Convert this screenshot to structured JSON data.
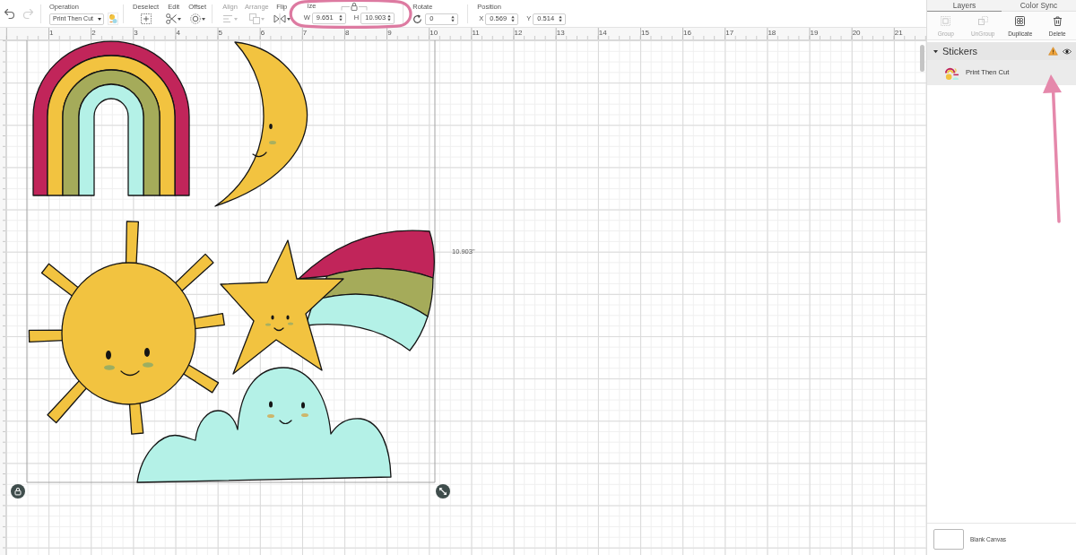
{
  "toolbar": {
    "history": [
      {
        "kind": "undo",
        "disabled": false
      },
      {
        "kind": "redo",
        "disabled": true
      }
    ],
    "operation": {
      "label": "Operation",
      "value": "Print Then Cut"
    },
    "tool_groups": [
      [
        {
          "kind": "deselect",
          "label": "Deselect",
          "disabled": false,
          "caret": false
        },
        {
          "kind": "edit",
          "label": "Edit",
          "disabled": false,
          "caret": true
        },
        {
          "kind": "offset",
          "label": "Offset",
          "disabled": false,
          "caret": true
        }
      ],
      [
        {
          "kind": "align",
          "label": "Align",
          "disabled": true,
          "caret": true
        },
        {
          "kind": "arrange",
          "label": "Arrange",
          "disabled": true,
          "caret": true
        },
        {
          "kind": "flip",
          "label": "Flip",
          "disabled": false,
          "caret": true
        }
      ]
    ],
    "size": {
      "label": "ize",
      "fields": [
        {
          "label": "W",
          "value": "9.651"
        },
        {
          "label": "H",
          "value": "10.903"
        }
      ]
    },
    "rotate": {
      "label": "Rotate",
      "value": "0"
    },
    "position": {
      "label": "Position",
      "fields": [
        {
          "label": "X",
          "value": "0.569"
        },
        {
          "label": "Y",
          "value": "0.514"
        }
      ]
    }
  },
  "ruler": {
    "numbers": [
      "1",
      "2",
      "3",
      "4",
      "5",
      "6",
      "7",
      "8",
      "9",
      "10",
      "11",
      "12",
      "13",
      "14",
      "15",
      "16",
      "17",
      "18",
      "19",
      "20",
      "21"
    ]
  },
  "canvas": {
    "dimension_label": "10.903\""
  },
  "panel": {
    "tabs": [
      {
        "label": "Layers",
        "selected": true
      },
      {
        "label": "Color Sync",
        "selected": false
      }
    ],
    "actions": [
      {
        "kind": "group",
        "label": "Group",
        "disabled": true
      },
      {
        "kind": "ungroup",
        "label": "UnGroup",
        "disabled": true
      },
      {
        "kind": "duplicate",
        "label": "Duplicate",
        "disabled": false
      },
      {
        "kind": "delete",
        "label": "Delete",
        "disabled": false
      }
    ],
    "layers": [
      {
        "name": "Stickers",
        "expanded": true,
        "warning": true,
        "visible": true,
        "children": [
          {
            "name": "Print Then Cut"
          }
        ]
      }
    ],
    "canvas_option": {
      "label": "Blank Canvas"
    }
  }
}
